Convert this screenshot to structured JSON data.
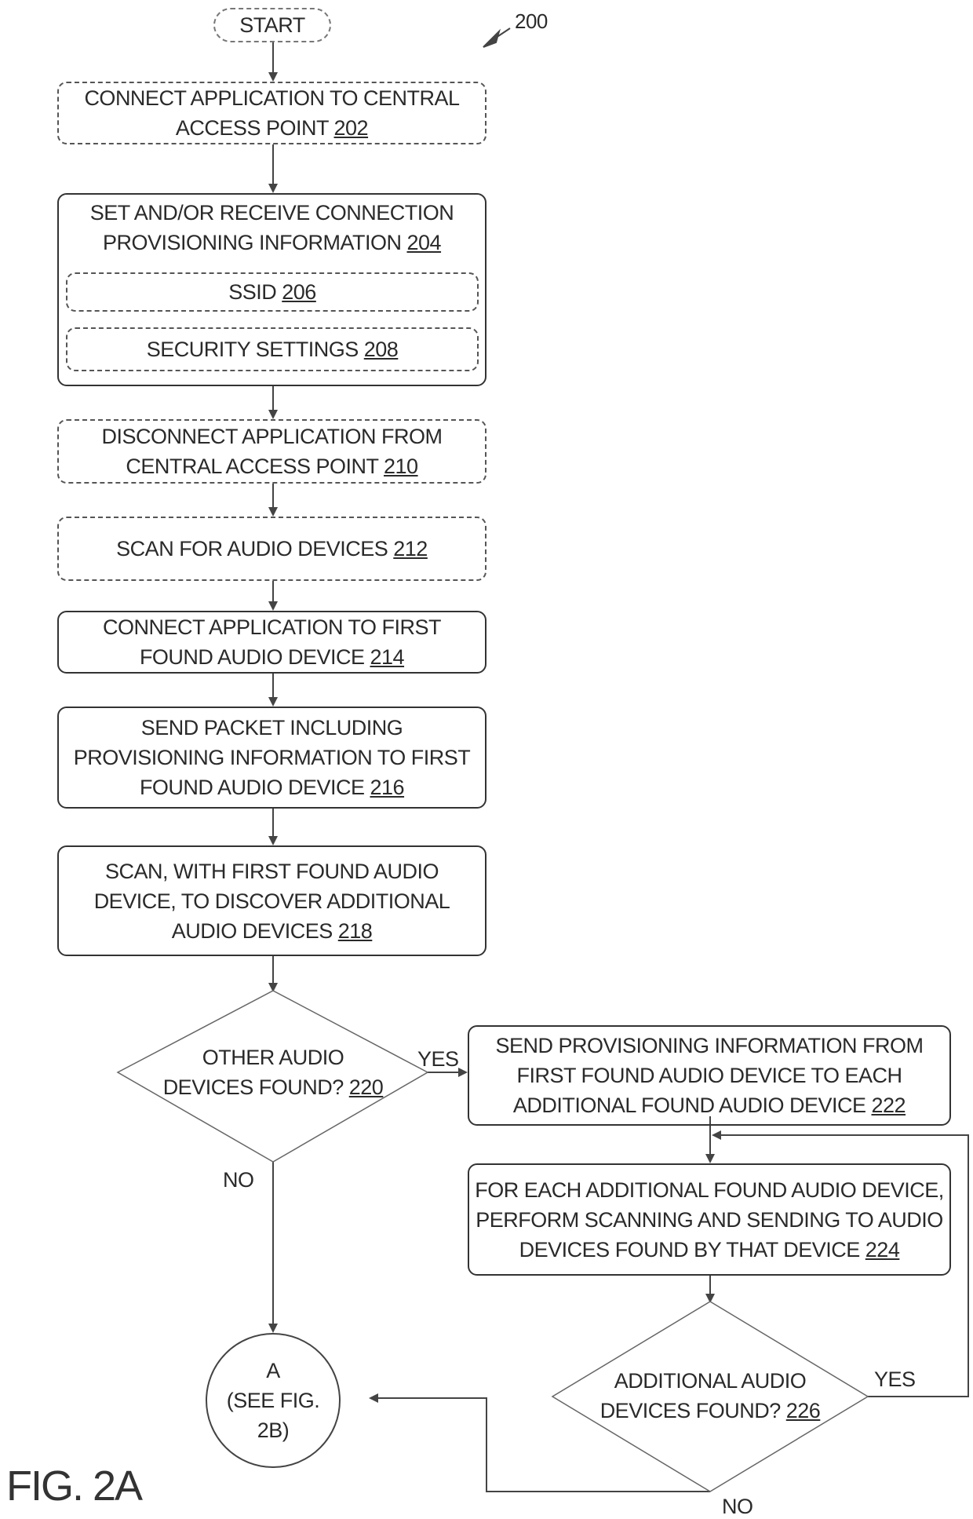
{
  "figure_number": "200",
  "figure_label": "FIG. 2A",
  "start": "START",
  "steps": {
    "s202": {
      "text": "CONNECT APPLICATION TO CENTRAL ACCESS POINT",
      "lines": [
        "CONNECT APPLICATION TO CENTRAL",
        "ACCESS POINT"
      ],
      "ref": "202"
    },
    "s204": {
      "lines": [
        "SET AND/OR RECEIVE CONNECTION",
        "PROVISIONING INFORMATION"
      ],
      "ref": "204"
    },
    "s206": {
      "text": "SSID",
      "ref": "206"
    },
    "s208": {
      "text": "SECURITY SETTINGS",
      "ref": "208"
    },
    "s210": {
      "lines": [
        "DISCONNECT APPLICATION FROM",
        "CENTRAL ACCESS POINT"
      ],
      "ref": "210"
    },
    "s212": {
      "text": "SCAN FOR AUDIO DEVICES",
      "ref": "212"
    },
    "s214": {
      "lines": [
        "CONNECT APPLICATION TO FIRST",
        "FOUND AUDIO DEVICE"
      ],
      "ref": "214"
    },
    "s216": {
      "lines": [
        "SEND PACKET INCLUDING",
        "PROVISIONING INFORMATION TO FIRST",
        "FOUND AUDIO DEVICE"
      ],
      "ref": "216"
    },
    "s218": {
      "lines": [
        "SCAN, WITH FIRST FOUND AUDIO",
        "DEVICE, TO DISCOVER ADDITIONAL",
        "AUDIO DEVICES"
      ],
      "ref": "218"
    },
    "s220": {
      "lines": [
        "OTHER AUDIO",
        "DEVICES FOUND?"
      ],
      "ref": "220"
    },
    "s222": {
      "lines": [
        "SEND PROVISIONING INFORMATION FROM",
        "FIRST FOUND AUDIO DEVICE TO EACH",
        "ADDITIONAL FOUND AUDIO DEVICE"
      ],
      "ref": "222"
    },
    "s224": {
      "lines": [
        "FOR EACH ADDITIONAL FOUND AUDIO DEVICE,",
        "PERFORM SCANNING AND SENDING TO AUDIO",
        "DEVICES FOUND BY THAT DEVICE"
      ],
      "ref": "224"
    },
    "s226": {
      "lines": [
        "ADDITIONAL AUDIO",
        "DEVICES FOUND?"
      ],
      "ref": "226"
    }
  },
  "connector": {
    "lines": [
      "A",
      "(SEE FIG.",
      "2B)"
    ]
  },
  "branch_labels": {
    "yes_220": "YES",
    "no_220": "NO",
    "yes_226": "YES",
    "no_226": "NO"
  }
}
